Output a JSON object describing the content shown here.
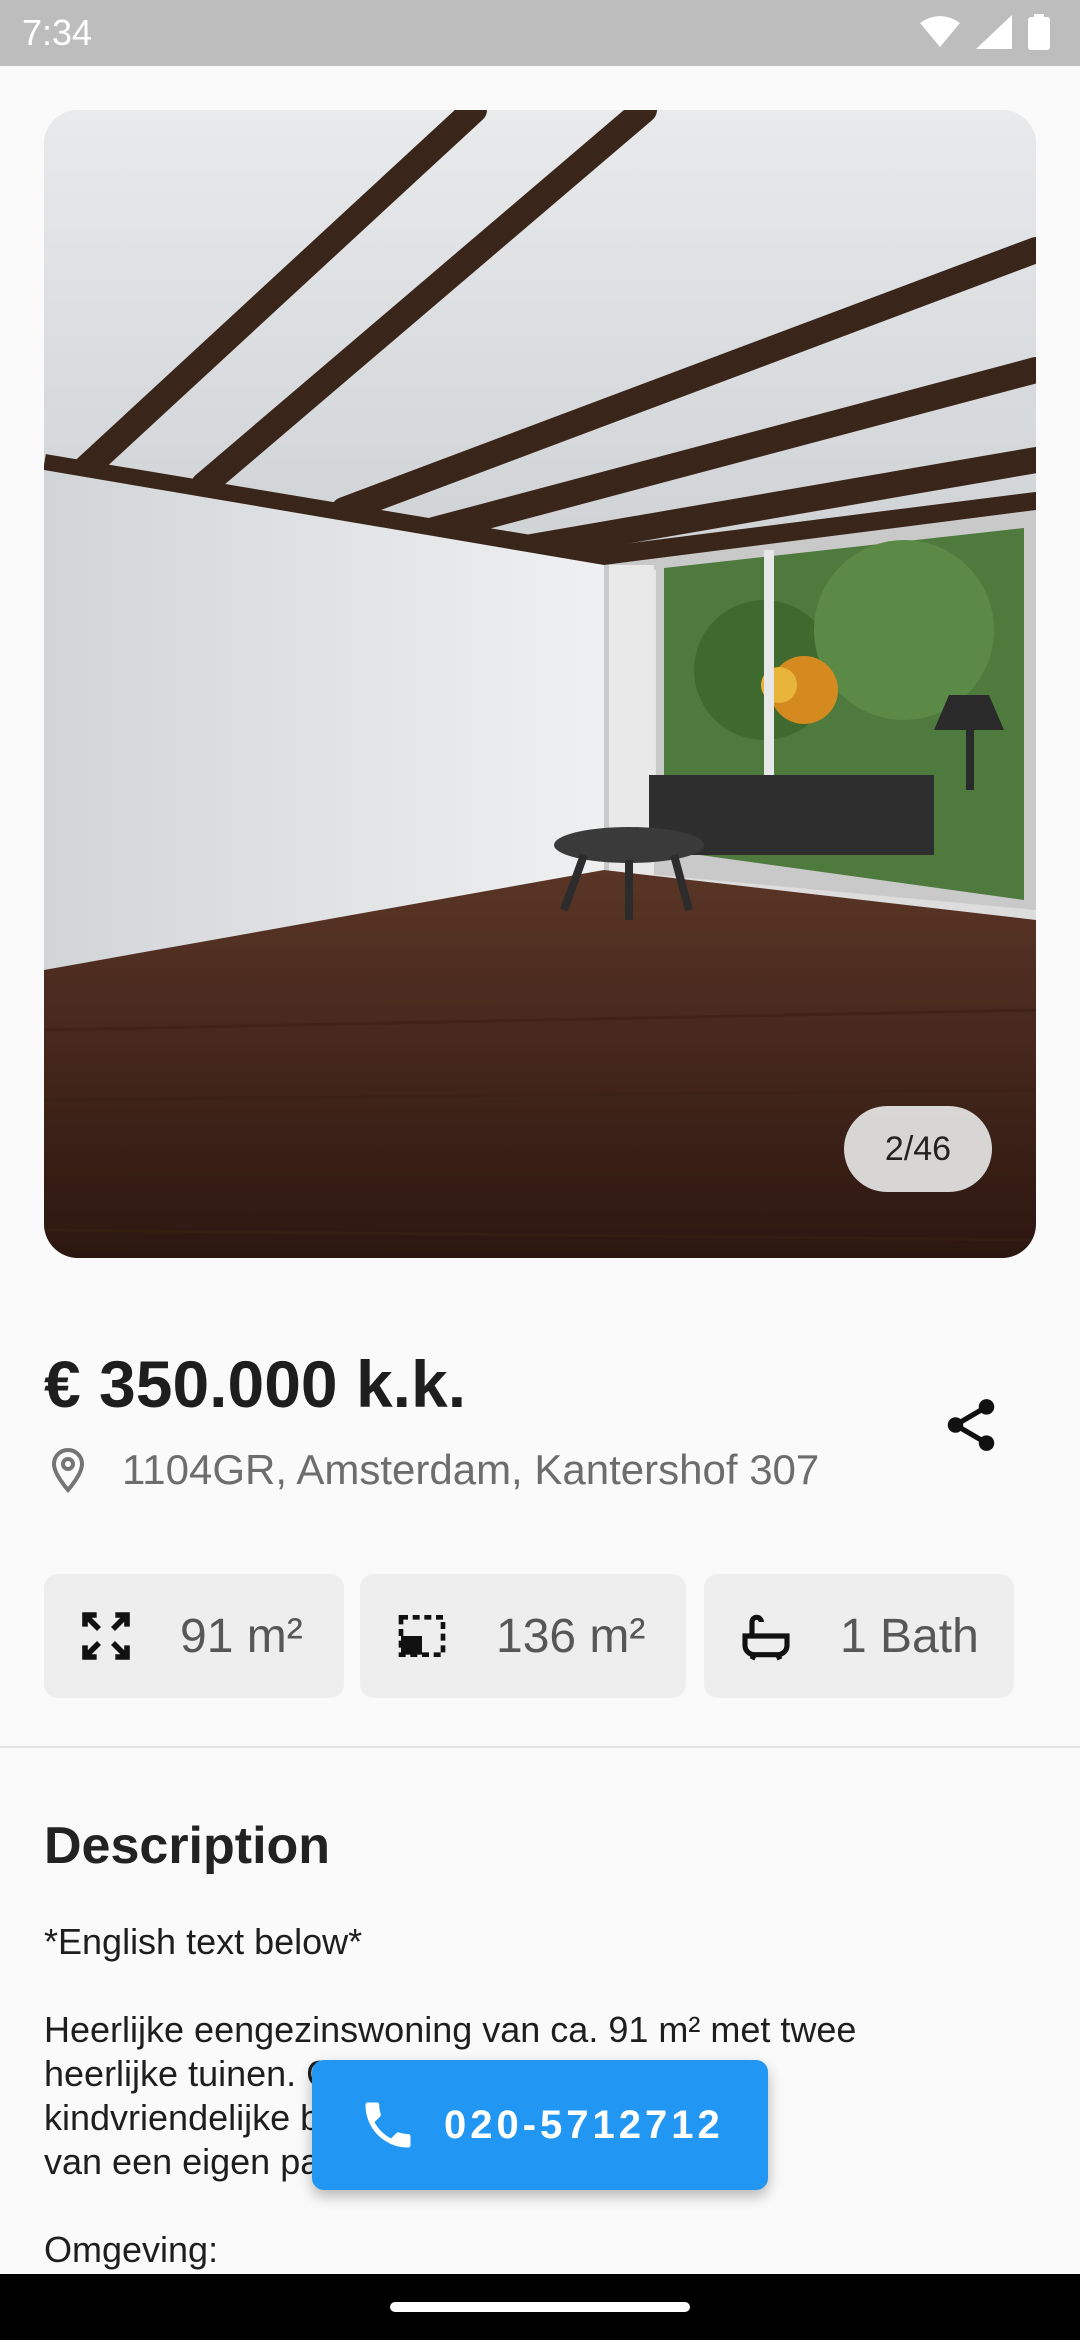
{
  "status_bar": {
    "time": "7:34",
    "icons": [
      "wifi-icon",
      "cell-signal-icon",
      "battery-icon"
    ]
  },
  "gallery": {
    "counter": "2/46"
  },
  "listing": {
    "price": "€ 350.000 k.k.",
    "address": "1104GR, Amsterdam, Kantershof 307"
  },
  "features": [
    {
      "icon": "expand-area-icon",
      "label": "91 m²"
    },
    {
      "icon": "plot-area-icon",
      "label": "136 m²"
    },
    {
      "icon": "bathtub-icon",
      "label": "1 Bath"
    }
  ],
  "description": {
    "title": "Description",
    "text": "*English text below*\n\nHeerlijke eengezinswoning van ca. 91 m² met twee\nheerlijke tuinen. Gelegen in een rustige en\nkindvriendelijke buurt. De woning voorzien\nvan een eigen parkeerplaats.\n\nOmgeving:"
  },
  "call_button": {
    "label": "020-5712712"
  },
  "colors": {
    "accent": "#2196f3",
    "status_bar": "#bdbdbd"
  }
}
